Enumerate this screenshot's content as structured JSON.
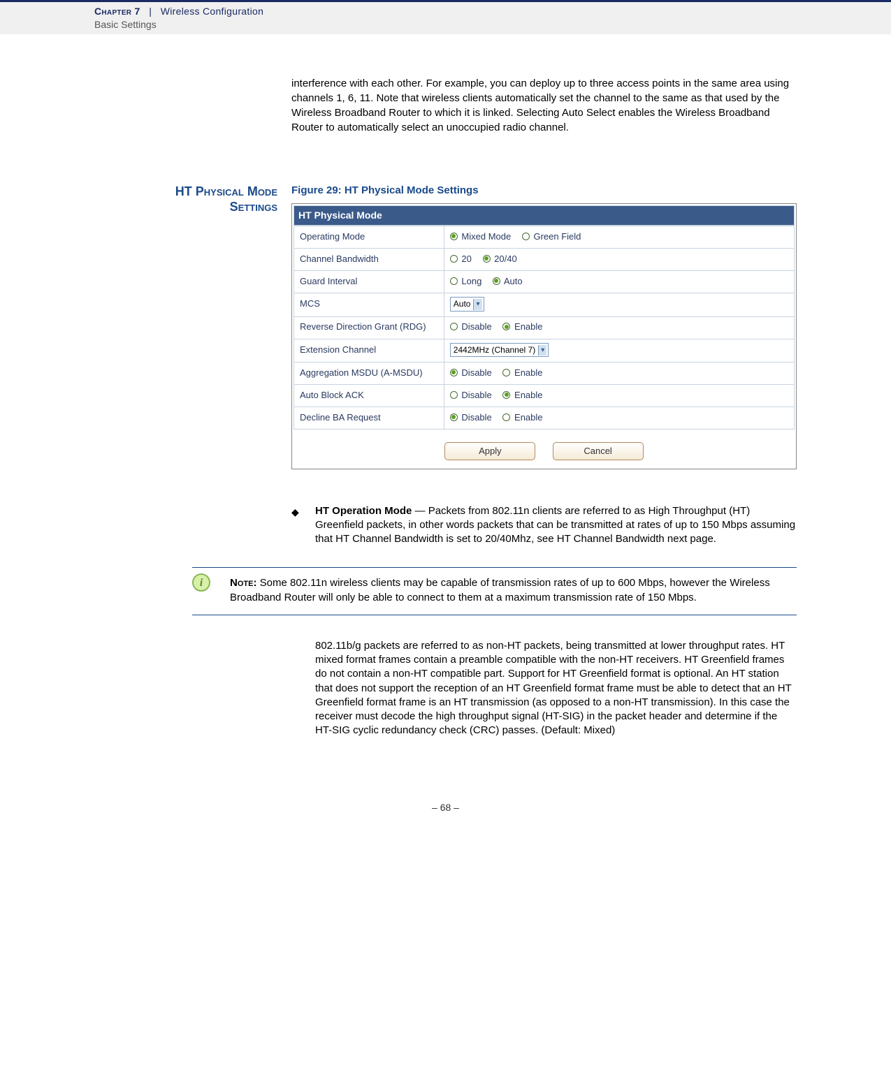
{
  "header": {
    "chapter_label": "Chapter",
    "chapter_number": "7",
    "separator": "|",
    "chapter_title": "Wireless Configuration",
    "subtitle": "Basic Settings"
  },
  "intro_paragraph": "interference with each other. For example, you can deploy up to three access points in the same area using channels 1, 6, 11. Note that wireless clients automatically set the channel to the same as that used by the Wireless Broadband Router to which it is linked. Selecting Auto Select enables the Wireless Broadband Router to automatically select an unoccupied radio channel.",
  "section_heading_line1": "HT Physical Mode",
  "section_heading_line2": "Settings",
  "figure_caption": "Figure 29:  HT Physical Mode Settings",
  "ht_panel_title": "HT Physical Mode",
  "ht_rows": {
    "operating_mode": {
      "label": "Operating Mode",
      "opt1": "Mixed Mode",
      "opt2": "Green Field",
      "selected": 0
    },
    "channel_bw": {
      "label": "Channel Bandwidth",
      "opt1": "20",
      "opt2": "20/40",
      "selected": 1
    },
    "guard_interval": {
      "label": "Guard Interval",
      "opt1": "Long",
      "opt2": "Auto",
      "selected": 1
    },
    "mcs": {
      "label": "MCS",
      "value": "Auto"
    },
    "rdg": {
      "label": "Reverse Direction Grant (RDG)",
      "opt1": "Disable",
      "opt2": "Enable",
      "selected": 1
    },
    "ext_channel": {
      "label": "Extension Channel",
      "value": "2442MHz (Channel 7)"
    },
    "amsdu": {
      "label": "Aggregation MSDU (A-MSDU)",
      "opt1": "Disable",
      "opt2": "Enable",
      "selected": 0
    },
    "auto_block_ack": {
      "label": "Auto Block ACK",
      "opt1": "Disable",
      "opt2": "Enable",
      "selected": 1
    },
    "decline_ba": {
      "label": "Decline BA Request",
      "opt1": "Disable",
      "opt2": "Enable",
      "selected": 0
    }
  },
  "buttons": {
    "apply": "Apply",
    "cancel": "Cancel"
  },
  "bullet": {
    "title": "HT Operation Mode",
    "dash": " — ",
    "body": "Packets from 802.11n clients are referred to as High Throughput (HT) Greenfield packets, in other words packets that can be transmitted at rates of up to 150 Mbps assuming that HT Channel Bandwidth is set to 20/40Mhz, see HT Channel Bandwidth next page."
  },
  "note": {
    "label": "Note:",
    "body": " Some 802.11n wireless clients may be capable of transmission rates of up to 600 Mbps, however the Wireless Broadband Router will only be able to connect to them at a maximum transmission rate of 150 Mbps."
  },
  "after_note_paragraph": "802.11b/g packets are referred to as non-HT packets, being transmitted at lower throughput rates. HT mixed format frames contain a preamble compatible with the non-HT receivers. HT Greenfield frames do not contain a non-HT compatible part.  Support for HT Greenfield format is optional. An HT station that does not support the reception of an HT Greenfield format frame must be able to detect that an HT Greenfield format frame is an HT transmission (as opposed to a non-HT transmission). In this case the receiver must decode the high throughput signal (HT-SIG) in the packet header and determine if the HT-SIG cyclic redundancy check (CRC) passes. (Default: Mixed)",
  "footer": "–  68  –"
}
